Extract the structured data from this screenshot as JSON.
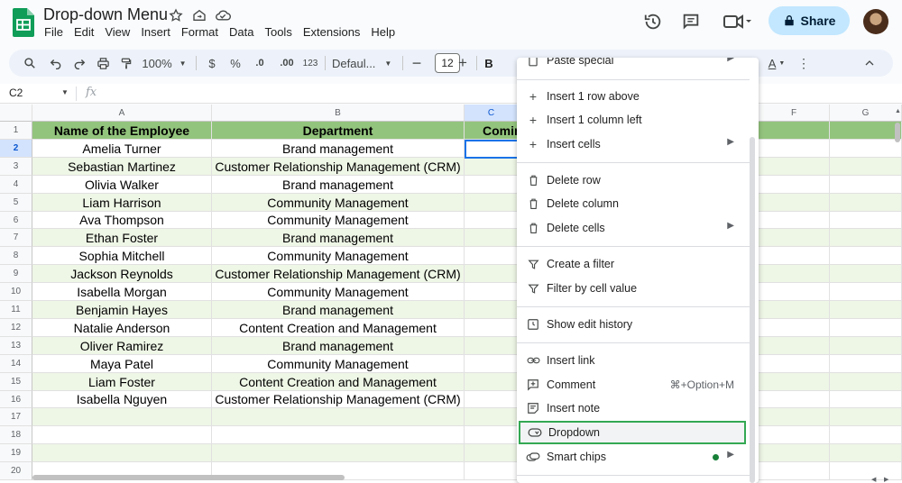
{
  "header": {
    "title": "Drop-down Menu",
    "menu": [
      "File",
      "Edit",
      "View",
      "Insert",
      "Format",
      "Data",
      "Tools",
      "Extensions",
      "Help"
    ],
    "share_label": "Share"
  },
  "toolbar": {
    "zoom": "100%",
    "currency": "$",
    "percent": "%",
    "decrease_decimal": ".0",
    "increase_decimal": ".00",
    "number_format": "123",
    "font": "Defaul...",
    "font_size": "12",
    "bold": "B"
  },
  "formula_bar": {
    "name_box": "C2",
    "fx": "fx"
  },
  "sheet": {
    "columns": [
      "A",
      "B",
      "C",
      "F",
      "G"
    ],
    "rows": [
      "1",
      "2",
      "3",
      "4",
      "5",
      "6",
      "7",
      "8",
      "9",
      "10",
      "11",
      "12",
      "13",
      "14",
      "15",
      "16",
      "17",
      "18",
      "19",
      "20"
    ],
    "header": {
      "name": "Name of the Employee",
      "department": "Department",
      "partial": "Comin"
    },
    "employees": [
      {
        "name": "Amelia Turner",
        "department": "Brand management"
      },
      {
        "name": "Sebastian Martinez",
        "department": "Customer Relationship Management (CRM)"
      },
      {
        "name": "Olivia Walker",
        "department": "Brand management"
      },
      {
        "name": "Liam Harrison",
        "department": "Community Management"
      },
      {
        "name": "Ava Thompson",
        "department": "Community Management"
      },
      {
        "name": "Ethan Foster",
        "department": "Brand management"
      },
      {
        "name": "Sophia Mitchell",
        "department": "Community Management"
      },
      {
        "name": "Jackson Reynolds",
        "department": "Customer Relationship Management (CRM)"
      },
      {
        "name": "Isabella Morgan",
        "department": "Community Management"
      },
      {
        "name": "Benjamin Hayes",
        "department": "Brand management"
      },
      {
        "name": "Natalie Anderson",
        "department": "Content Creation and Management"
      },
      {
        "name": "Oliver Ramirez",
        "department": "Brand management"
      },
      {
        "name": "Maya Patel",
        "department": "Community Management"
      },
      {
        "name": "Liam Foster",
        "department": "Content Creation and Management"
      },
      {
        "name": "Isabella Nguyen",
        "department": "Customer Relationship Management (CRM)"
      }
    ],
    "colors": {
      "header": "#93c47d",
      "band": "#eef6e6",
      "selection": "#1a73e8"
    }
  },
  "context_menu": {
    "paste_special": "Paste special",
    "insert_row_above": "Insert 1 row above",
    "insert_column_left": "Insert 1 column left",
    "insert_cells": "Insert cells",
    "delete_row": "Delete row",
    "delete_column": "Delete column",
    "delete_cells": "Delete cells",
    "create_filter": "Create a filter",
    "filter_by_value": "Filter by cell value",
    "show_edit_history": "Show edit history",
    "insert_link": "Insert link",
    "comment": "Comment",
    "comment_shortcut": "⌘+Option+M",
    "insert_note": "Insert note",
    "dropdown": "Dropdown",
    "smart_chips": "Smart chips",
    "highlight_color": "#34a853"
  }
}
